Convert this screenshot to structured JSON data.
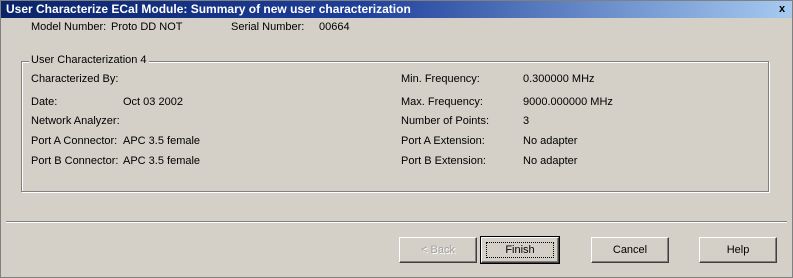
{
  "window": {
    "title": "User Characterize ECal Module: Summary of new user characterization",
    "close_glyph": "x"
  },
  "info": {
    "model_label": "Model Number:",
    "model_value": "Proto DD NOT",
    "serial_label": "Serial Number:",
    "serial_value": "00664"
  },
  "group": {
    "legend": "User Characterization 4",
    "left": [
      {
        "label": "Characterized By:",
        "value": ""
      },
      {
        "label": "Date:",
        "value": "Oct 03 2002"
      },
      {
        "label": "Network Analyzer:",
        "value": ""
      },
      {
        "label": "Port A Connector:",
        "value": "APC 3.5 female"
      },
      {
        "label": "Port B Connector:",
        "value": "APC 3.5 female"
      }
    ],
    "right": [
      {
        "label": "Min. Frequency:",
        "value": "0.300000 MHz"
      },
      {
        "label": "Max. Frequency:",
        "value": "9000.000000 MHz"
      },
      {
        "label": "Number of Points:",
        "value": "3"
      },
      {
        "label": "Port A Extension:",
        "value": "No adapter"
      },
      {
        "label": "Port B Extension:",
        "value": "No adapter"
      }
    ]
  },
  "buttons": {
    "back": "< Back",
    "finish": "Finish",
    "cancel": "Cancel",
    "help": "Help"
  }
}
